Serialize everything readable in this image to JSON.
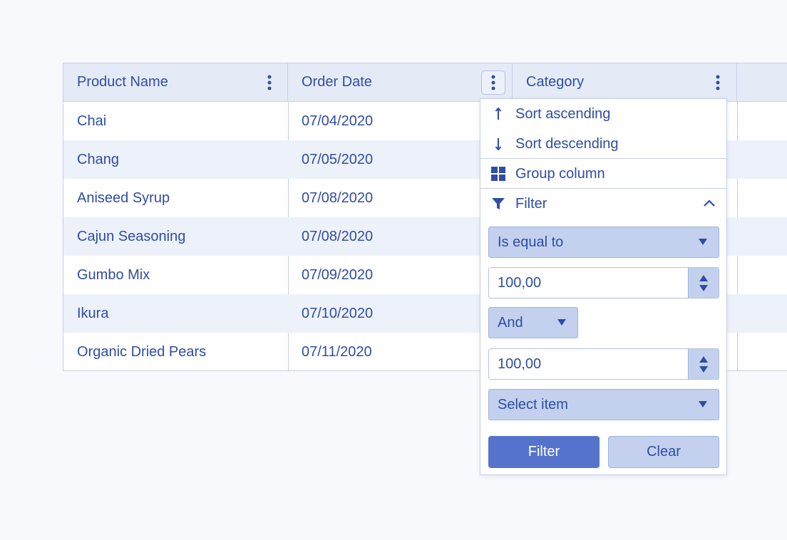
{
  "grid": {
    "columns": [
      {
        "title": "Product Name"
      },
      {
        "title": "Order Date"
      },
      {
        "title": "Category"
      },
      {
        "title": ""
      }
    ],
    "rows": [
      {
        "product": "Chai",
        "date": "07/04/2020"
      },
      {
        "product": "Chang",
        "date": "07/05/2020"
      },
      {
        "product": "Aniseed Syrup",
        "date": "07/08/2020"
      },
      {
        "product": "Cajun Seasoning",
        "date": "07/08/2020"
      },
      {
        "product": "Gumbo Mix",
        "date": "07/09/2020"
      },
      {
        "product": "Ikura",
        "date": "07/10/2020"
      },
      {
        "product": "Organic Dried Pears",
        "date": "07/11/2020"
      }
    ]
  },
  "column_menu": {
    "sort_ascending": "Sort ascending",
    "sort_descending": "Sort descending",
    "group_column": "Group column",
    "filter": "Filter",
    "operator_1": "Is equal to",
    "value_1": "100,00",
    "logic": "And",
    "value_2": "100,00",
    "operator_2": "Select item",
    "filter_button": "Filter",
    "clear_button": "Clear"
  },
  "colors": {
    "accent": "#5573cc",
    "text": "#2f4da3",
    "header_bg": "#e4ebf6",
    "alt_row_bg": "#edf1fa",
    "control_bg": "#c3d1ee"
  },
  "icons": [
    "more-vertical-icon",
    "arrow-up-icon",
    "arrow-down-icon",
    "group-icon",
    "filter-icon",
    "chevron-up-icon",
    "caret-down-icon",
    "spinner-up-icon",
    "spinner-down-icon"
  ]
}
